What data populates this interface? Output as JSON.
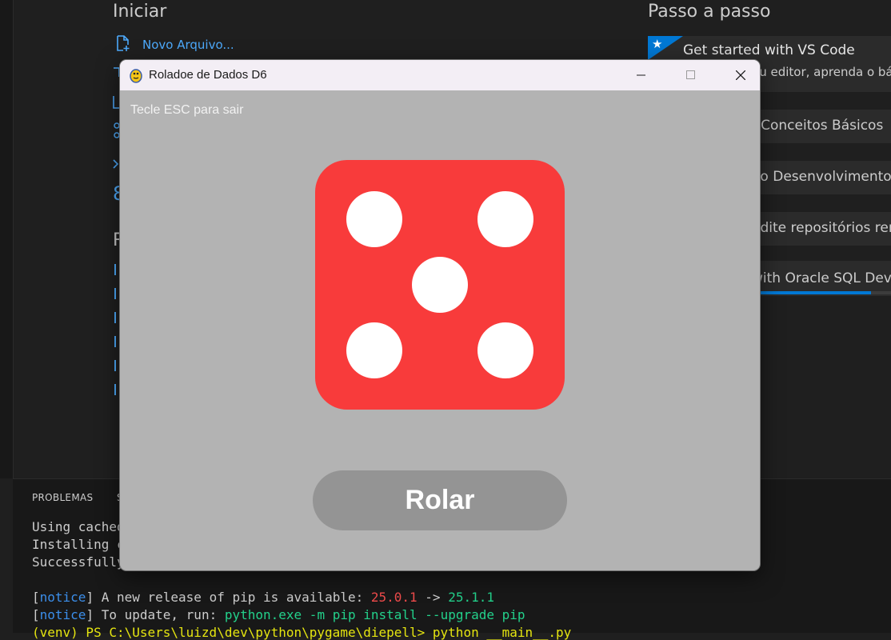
{
  "vscode": {
    "start": {
      "heading": "Iniciar",
      "new_file_label": "Novo Arquivo...",
      "partial_chars": [
        "8"
      ]
    },
    "recent": {
      "heading_partial": "R"
    },
    "walkthroughs": {
      "heading": "Passo a passo",
      "items": [
        {
          "title": "Get started with VS Code",
          "desc_fragment": "eu editor, aprenda o bá"
        },
        {
          "title_fragment": ": Conceitos Básicos"
        },
        {
          "title_fragment": "ao Desenvolvimento c"
        },
        {
          "title_fragment": "edite repositórios rem"
        },
        {
          "title_fragment": "with Oracle SQL Deve",
          "progress": 0.85
        }
      ]
    },
    "panel": {
      "tab_label": "PROBLEMAS",
      "tab_partial": "S",
      "terminal_lines": [
        "Using cached",
        "Installing co",
        "Successfully"
      ],
      "notice1": {
        "tag": "notice",
        "text": " A new release of pip is available: ",
        "old_version": "25.0.1",
        "arrow": " -> ",
        "new_version": "25.1.1"
      },
      "notice2": {
        "tag": "notice",
        "text": " To update, run: ",
        "command": "python.exe -m pip install --upgrade pip"
      },
      "prompt_partial": "(venv) PS C:\\Users\\luizd\\dev\\python\\pygame\\diepell> python __main__.py"
    }
  },
  "window": {
    "title": "Roladoe de Dados D6",
    "hint": "Tecle ESC para sair",
    "die_value": 5,
    "roll_button": "Rolar",
    "colors": {
      "die": "#f83b3b",
      "pip": "#ffffff",
      "background": "#b3b3b3",
      "button": "#949494"
    }
  }
}
